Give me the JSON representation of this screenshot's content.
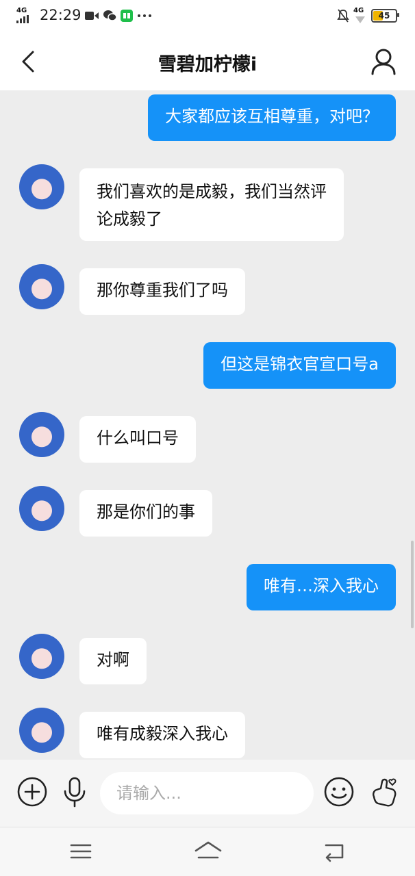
{
  "status_bar": {
    "network": "4G",
    "time": "22:29",
    "right_network": "4G",
    "battery_level": "45",
    "icons": [
      "video-icon",
      "wechat-icon",
      "app-icon",
      "more-dots-icon",
      "mute-bell-icon"
    ]
  },
  "header": {
    "title": "雪碧加柠檬i",
    "back_icon": "back-chevron-icon",
    "profile_icon": "profile-icon"
  },
  "messages": [
    {
      "direction": "out",
      "text": "大家都应该互相尊重，对吧？"
    },
    {
      "direction": "in",
      "lines": [
        "我们喜欢的是成毅，我们当然评",
        "论成毅了"
      ]
    },
    {
      "direction": "in",
      "text": "那你尊重我们了吗"
    },
    {
      "direction": "out",
      "text": "但这是锦衣官宣口号a"
    },
    {
      "direction": "in",
      "text": "什么叫口号"
    },
    {
      "direction": "in",
      "text": "那是你们的事"
    },
    {
      "direction": "out",
      "text": "唯有…深入我心"
    },
    {
      "direction": "in",
      "text": "对啊"
    },
    {
      "direction": "in",
      "text": "唯有成毅深入我心"
    }
  ],
  "input_bar": {
    "placeholder": "请输入...",
    "icons": [
      "add-icon",
      "microphone-icon",
      "emoji-icon",
      "hand-heart-icon"
    ]
  },
  "system_nav": {
    "icons": [
      "menu-icon",
      "home-icon",
      "back-icon"
    ]
  },
  "colors": {
    "outgoing_bubble": "#1592f8",
    "incoming_bubble": "#ffffff",
    "chat_background": "#ededed"
  }
}
